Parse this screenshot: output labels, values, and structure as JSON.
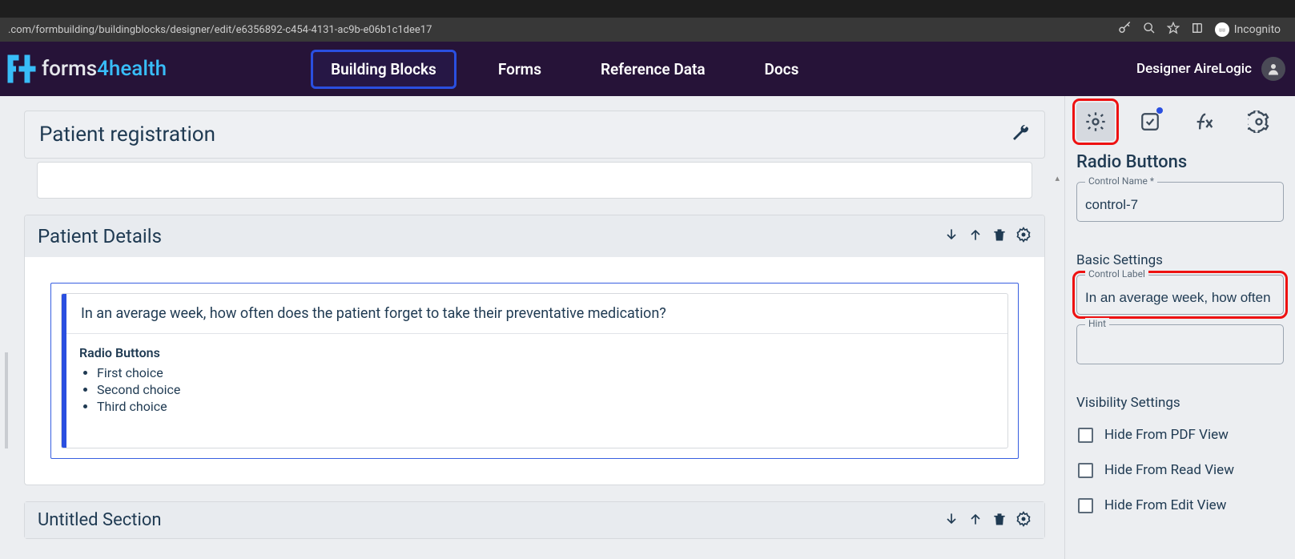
{
  "browser": {
    "url": ".com/formbuilding/buildingblocks/designer/edit/e6356892-c454-4131-ac9b-e06b1c1dee17",
    "incognito_label": "Incognito"
  },
  "logo": {
    "text_a": "forms",
    "text_b": "4health"
  },
  "nav": {
    "building_blocks": "Building Blocks",
    "forms": "Forms",
    "reference_data": "Reference Data",
    "docs": "Docs"
  },
  "user": {
    "name": "Designer AireLogic"
  },
  "page": {
    "title": "Patient registration"
  },
  "section": {
    "title": "Patient Details",
    "field_question": "In an average week, how often does the patient forget to take their preventative medication?",
    "field_type_label": "Radio Buttons",
    "choices": [
      "First choice",
      "Second choice",
      "Third choice"
    ]
  },
  "next_section": {
    "title": "Untitled Section"
  },
  "side_panel": {
    "heading": "Radio Buttons",
    "control_name_label": "Control Name *",
    "control_name_value": "control-7",
    "basic_settings": "Basic Settings",
    "control_label_label": "Control Label",
    "control_label_value": "In an average week, how often",
    "hint_label": "Hint",
    "hint_value": "",
    "visibility_settings": "Visibility Settings",
    "hide_pdf": "Hide From PDF View",
    "hide_read": "Hide From Read View",
    "hide_edit": "Hide From Edit View"
  }
}
